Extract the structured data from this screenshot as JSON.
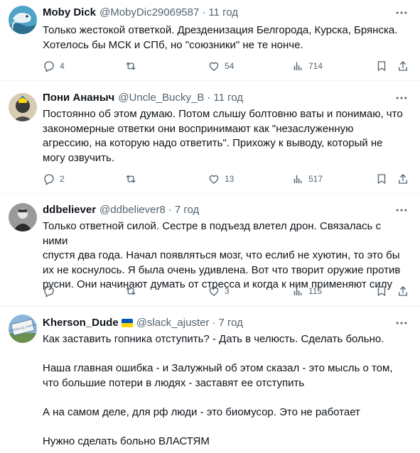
{
  "tweets": [
    {
      "name": "Moby Dick",
      "handle": "@MobyDic29069587",
      "time": "11 год",
      "text": "Только жестокой ответкой. Дрезденизация Белгорода, Курска, Брянска.\nХотелось бы МСК и СПб, но \"союзники\" не те нонче.",
      "replies": "4",
      "retweets": "",
      "likes": "54",
      "views": "714"
    },
    {
      "name": "Пони Ананыч",
      "handle": "@Uncle_Bucky_B",
      "time": "11 год",
      "text": "Постоянно об этом думаю. Потом слышу болтовню ваты и понимаю, что\nзакономерные ответки они воспринимают как \"незаслуженную\nагрессию, на которую надо ответить\". Прихожу к выводу, который не\nмогу озвучить.",
      "replies": "2",
      "retweets": "",
      "likes": "13",
      "views": "517"
    },
    {
      "name": "ddbeliever",
      "handle": "@ddbeliever8",
      "time": "7 год",
      "text": "Только ответной силой. Сестре в подъезд влетел дрон. Связалась с ними\nспустя два года. Начал появляться мозг, что еслиб не хуютин, то это бы\nих не коснулось. Я была очень удивлена. Вот что творит оружие против\nрусни. Они начинают думать от стресса и когда к ним применяют силу",
      "replies": "",
      "retweets": "",
      "likes": "3",
      "views": "115"
    },
    {
      "name": "Kherson_Dude",
      "handle": "@slack_ajuster",
      "time": "7 год",
      "text": "Как заставить гопника отступить? - Дать в челюсть. Сделать больно.\n\nНаша главная ошибка - и Залужный об этом сказал - это мысль о том,\nчто большие потери в людях - заставят ее отступить\n\nА на самом деле, для рф люди - это биомусор. Это не работает\n\nНужно сделать больно ВЛАСТЯМ",
      "avatar_sign_text": "ХЕРСОН ЦЕ УКРАЇНА"
    }
  ],
  "colors": {
    "text": "#0f1419",
    "secondary": "#536471",
    "divider": "#eff3f4",
    "flag_blue": "#0057b7",
    "flag_yellow": "#ffd700"
  },
  "icons": [
    "reply-icon",
    "retweet-icon",
    "like-icon",
    "views-icon",
    "bookmark-icon",
    "share-icon",
    "more-icon"
  ]
}
